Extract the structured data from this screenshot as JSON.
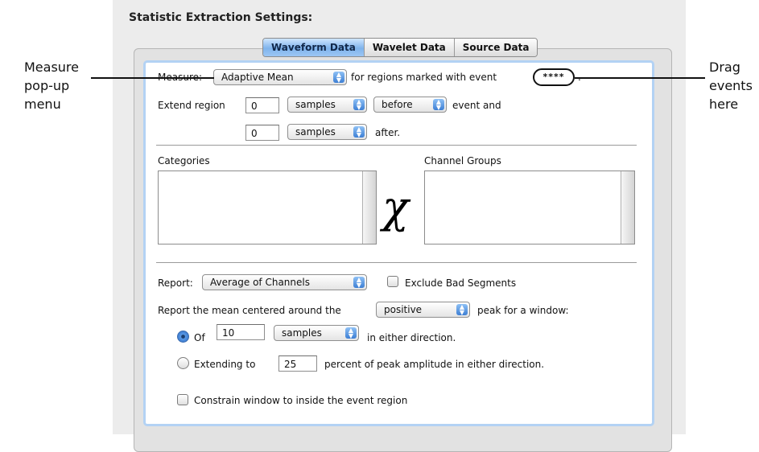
{
  "callouts": {
    "left": [
      "Measure",
      "pop-up",
      "menu"
    ],
    "right": [
      "Drag",
      "events",
      "here"
    ]
  },
  "pane": {
    "title": "Statistic Extraction Settings:",
    "tabs": [
      {
        "label": "Waveform Data",
        "active": true
      },
      {
        "label": "Wavelet Data",
        "active": false
      },
      {
        "label": "Source Data",
        "active": false
      }
    ]
  },
  "measure": {
    "label": "Measure:",
    "value": "Adaptive Mean",
    "suffix": "for regions marked with event",
    "event_token": "****",
    "period": "."
  },
  "extend": {
    "label": "Extend region",
    "before_value": "0",
    "before_unit": "samples",
    "direction": "before",
    "event_and": "event and",
    "after_value": "0",
    "after_unit": "samples",
    "after_label": "after."
  },
  "lists": {
    "categories_label": "Categories",
    "channel_groups_label": "Channel Groups",
    "product_symbol": "χ"
  },
  "report": {
    "label": "Report:",
    "value": "Average of Channels",
    "exclude_label": "Exclude Bad Segments",
    "exclude_checked": false,
    "center_text": "Report the mean centered around the",
    "peak_polarity": "positive",
    "peak_suffix": "peak for a window:",
    "of_label": "Of",
    "of_value": "10",
    "of_unit": "samples",
    "of_suffix": "in either direction.",
    "of_selected": true,
    "extending_label": "Extending to",
    "extending_value": "25",
    "extending_suffix": "percent of peak amplitude in either direction.",
    "extending_selected": false,
    "constrain_label": "Constrain window to inside the event region",
    "constrain_checked": false
  },
  "colors": {
    "tab_active": "#7fb3ec",
    "group_border": "#b3d2f4",
    "popup_arrow": "#3d7fd4"
  }
}
